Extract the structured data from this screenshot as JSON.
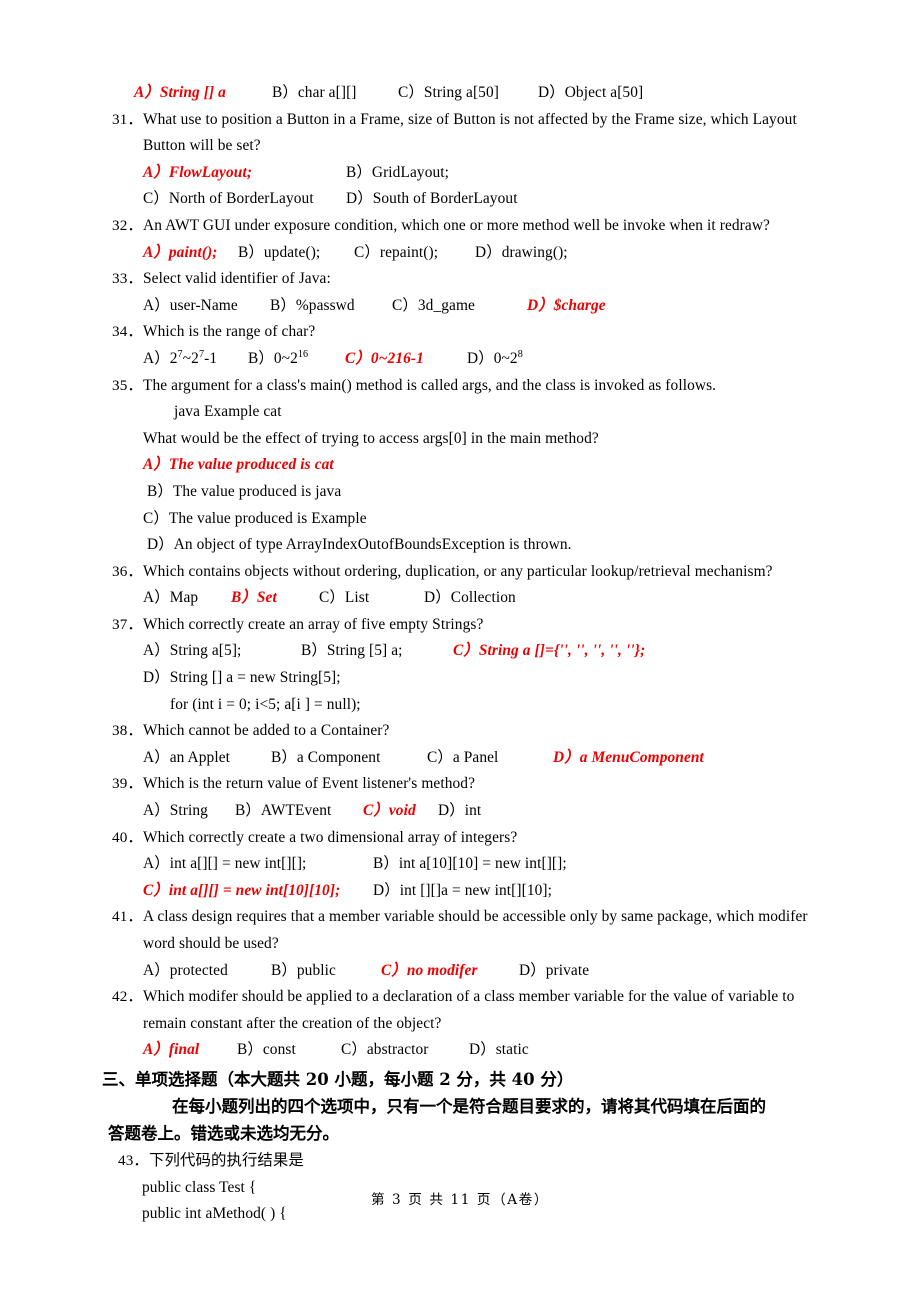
{
  "document": {
    "type": "exam-paper",
    "answer_color": "#ee0000",
    "body_color": "#000000",
    "background": "#ffffff"
  },
  "top_options_line": {
    "a": "A）String [] a",
    "b": "B）char a[][]",
    "c": "C）String a[50]",
    "d": "D）Object a[50]"
  },
  "questions": [
    {
      "num": "31．",
      "stem": "What use to position a Button in a Frame, size of Button is not affected by the Frame size, which Layout",
      "stem2": "Button will be set?",
      "options": [
        {
          "label": "A）FlowLayout;",
          "answer": true
        },
        {
          "label": "B）GridLayout;",
          "answer": false
        },
        {
          "label": "C）North of BorderLayout",
          "answer": false
        },
        {
          "label": "D）South of BorderLayout",
          "answer": false
        }
      ]
    },
    {
      "num": "32．",
      "stem": "An AWT GUI under exposure condition, which one or more method well be invoke when it redraw?",
      "options": [
        {
          "label": "A）paint();",
          "answer": true
        },
        {
          "label": "B）update();",
          "answer": false
        },
        {
          "label": "C）repaint();",
          "answer": false
        },
        {
          "label": "D）drawing();",
          "answer": false
        }
      ]
    },
    {
      "num": "33．",
      "stem": "Select valid identifier of Java:",
      "options": [
        {
          "label": "A）user-Name",
          "answer": false
        },
        {
          "label": "B）%passwd",
          "answer": false
        },
        {
          "label": "C）3d_game",
          "answer": false
        },
        {
          "label": "D）$charge",
          "answer": true
        }
      ]
    },
    {
      "num": "34．",
      "stem": "Which is the range of char?",
      "options": [
        {
          "label": "A）2^7~2^7-1",
          "answer": false
        },
        {
          "label": "B）0~2^16",
          "answer": false
        },
        {
          "label": "C）0~216-1",
          "answer": true
        },
        {
          "label": "D）0~2^8",
          "answer": false
        }
      ]
    },
    {
      "num": "35．",
      "stem": "The argument for a class's main() method is called args, and the class is invoked as follows.",
      "code": "java Example cat",
      "stem2": "What would be the effect of trying to access args[0] in the main method?",
      "options": [
        {
          "label": "A）The value produced is cat",
          "answer": true
        },
        {
          "label": "B）The value produced is java",
          "answer": false
        },
        {
          "label": "C）The value produced is Example",
          "answer": false
        },
        {
          "label": "D）An object of type ArrayIndexOutofBoundsException is thrown.",
          "answer": false
        }
      ]
    },
    {
      "num": "36．",
      "stem": "Which contains objects without ordering, duplication, or any particular lookup/retrieval mechanism?",
      "options": [
        {
          "label": "A）Map",
          "answer": false
        },
        {
          "label": "B）Set",
          "answer": true
        },
        {
          "label": "C）List",
          "answer": false
        },
        {
          "label": "D）Collection",
          "answer": false
        }
      ]
    },
    {
      "num": "37．",
      "stem": "Which correctly create an array of five empty Strings?",
      "options": [
        {
          "label": "A）String a[5];",
          "answer": false
        },
        {
          "label": "B）String [5] a;",
          "answer": false
        },
        {
          "label": "C）String a []={'', '', '', '', ''};",
          "answer": true
        },
        {
          "label": "D）String [] a = new String[5];",
          "answer": false
        }
      ],
      "extra": "for (int i = 0; i<5; a[i ] = null);"
    },
    {
      "num": "38．",
      "stem": "Which cannot be added to a Container?",
      "options": [
        {
          "label": "A）an Applet",
          "answer": false
        },
        {
          "label": "B）a Component",
          "answer": false
        },
        {
          "label": "C）a Panel",
          "answer": false
        },
        {
          "label": "D）a MenuComponent",
          "answer": true
        }
      ]
    },
    {
      "num": "39．",
      "stem": "Which is the return value of Event listener's method?",
      "options": [
        {
          "label": "A）String",
          "answer": false
        },
        {
          "label": "B）AWTEvent",
          "answer": false
        },
        {
          "label": "C）void",
          "answer": true
        },
        {
          "label": "D）int",
          "answer": false
        }
      ]
    },
    {
      "num": "40．",
      "stem": "Which correctly create a two dimensional array of integers?",
      "options": [
        {
          "label": "A）int a[][] = new int[][];",
          "answer": false
        },
        {
          "label": "B）int a[10][10] = new int[][];",
          "answer": false
        },
        {
          "label": "C）int a[][] = new int[10][10];",
          "answer": true
        },
        {
          "label": "D）int [][]a = new int[][10];",
          "answer": false
        }
      ]
    },
    {
      "num": "41．",
      "stem": "A class design requires that a member variable should be accessible only by same package, which modifer",
      "stem2": "word should be used?",
      "options": [
        {
          "label": "A）protected",
          "answer": false
        },
        {
          "label": "B）public",
          "answer": false
        },
        {
          "label": "C）no modifer",
          "answer": true
        },
        {
          "label": "D）private",
          "answer": false
        }
      ]
    },
    {
      "num": "42．",
      "stem": "Which modifer should be applied to a declaration of a class member variable for the value of variable to",
      "stem2": "remain constant after the creation of the object?",
      "options": [
        {
          "label": "A）final",
          "answer": true
        },
        {
          "label": "B）const",
          "answer": false
        },
        {
          "label": "C）abstractor",
          "answer": false
        },
        {
          "label": "D）static",
          "answer": false
        }
      ]
    }
  ],
  "section": {
    "heading": "三、单项选择题（本大题共 20 小题，每小题 2 分，共 40 分）",
    "instruction_line1": "在每小题列出的四个选项中，只有一个是符合题目要求的，请将其代码填在后面的",
    "instruction_line2": "答题卷上。错选或未选均无分。"
  },
  "question43": {
    "num": "43．",
    "stem": "下列代码的执行结果是",
    "code_line1": "public class Test {",
    "code_line2": "public int aMethod( ) {"
  },
  "footer": {
    "text": "第 3 页 共 11 页（A卷）"
  }
}
